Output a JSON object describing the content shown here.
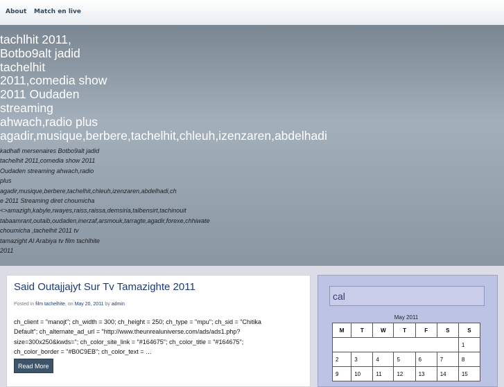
{
  "nav": {
    "about": "About",
    "match": "Match en live"
  },
  "header": {
    "title_lines": [
      "tachlhit 2011,",
      "Botbo9alt jadid",
      "tachelhit",
      "2011,comedia show",
      "2011 Oudaden",
      "streaming",
      "ahwach,radio plus",
      "agadir,musique,berbere,tachelhit,chleuh,izenzaren,abdelhadi"
    ],
    "description_lines": [
      "kadhafi mersenaires Botbo9alt jadid",
      "tachelhit 2011,comedia show 2011",
      "Oudaden streaming ahwach,radio",
      "plus",
      "agadir,musique,berbere,tachelhit,chleuh,izenzaren,abdelhadi,ch",
      "e 2011 Streaming diret choumicha",
      "<>amazigh,kabyle,rwayes,raiss,raissa,demsiria,talbensirt,tachinouit",
      "tabaamrant,outaib,oudaden,inerzaf,arsmouk,tarragte,agadir,forexe,chhiwate",
      "choumicha ,tachelhit 2011 tv",
      "tamazight Al Arabiya tv film tachlhite",
      "2011"
    ]
  },
  "post": {
    "title": "Said Outajjajyt Sur Tv Tamazighte 2011",
    "meta_posted_in": "Posted in ",
    "meta_category": "film tachelhite",
    "meta_on": ", on ",
    "meta_date": "May 20, 2011",
    "meta_by": " by ",
    "meta_author": "admin",
    "body_lines": [
      "ch_client = \"manojt\"; ch_width = 300; ch_height = 250; ch_type = \"mpu\"; ch_sid = \"Chitika",
      "Default\"; ch_alternate_ad_url = \"http://www.theunrealuniverse.com/ads/ads1.php?",
      "size=300x250&kwds=\"; ch_color_site_link = \"#164675\"; ch_color_title = \"#164675\";",
      "ch_color_border = \"#B0C9EB\"; ch_color_text = …"
    ],
    "read_more": "Read More"
  },
  "sidebar": {
    "widget_title": "cal",
    "calendar": {
      "caption": "May 2011",
      "weekdays": [
        "M",
        "T",
        "W",
        "T",
        "F",
        "S",
        "S"
      ],
      "rows": [
        [
          "",
          "",
          "",
          "",
          "",
          "",
          "1"
        ],
        [
          "2",
          "3",
          "4",
          "5",
          "6",
          "7",
          "8"
        ],
        [
          "9",
          "10",
          "11",
          "12",
          "13",
          "14",
          "15"
        ]
      ]
    }
  },
  "colors": {
    "link": "#1d3a78",
    "button_bg": "#3d5469",
    "sidebar_bg": "#bdc3e4"
  }
}
